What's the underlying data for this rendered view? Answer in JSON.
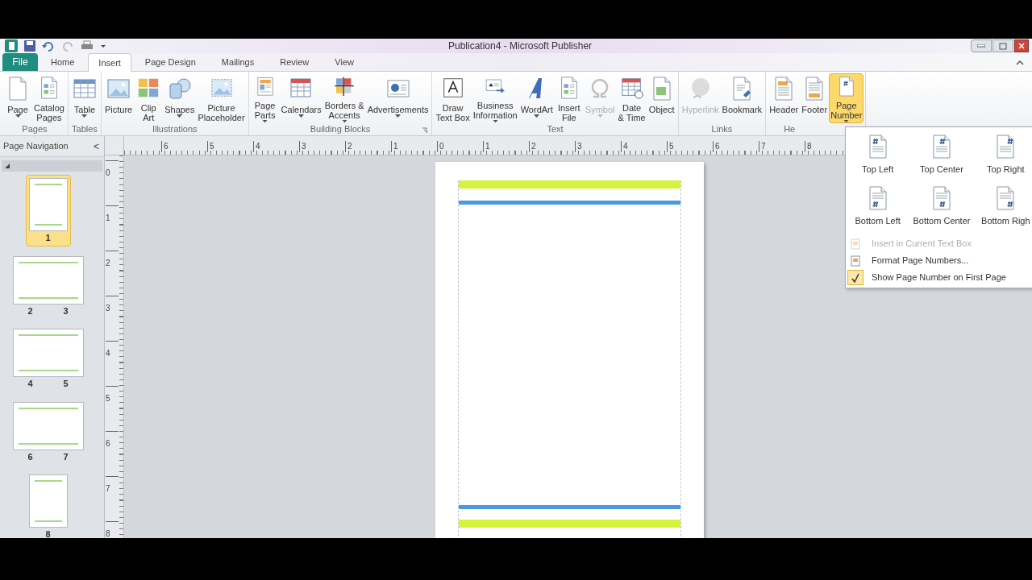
{
  "window": {
    "title": "Publication4  -  Microsoft Publisher"
  },
  "tabs": [
    {
      "label": "File",
      "kind": "file",
      "selected": false
    },
    {
      "label": "Home",
      "kind": "tab",
      "selected": false
    },
    {
      "label": "Insert",
      "kind": "tab",
      "selected": true
    },
    {
      "label": "Page Design",
      "kind": "tab",
      "selected": false
    },
    {
      "label": "Mailings",
      "kind": "tab",
      "selected": false
    },
    {
      "label": "Review",
      "kind": "tab",
      "selected": false
    },
    {
      "label": "View",
      "kind": "tab",
      "selected": false
    }
  ],
  "ribbon": {
    "groups": [
      {
        "label": "Pages",
        "launcher": false,
        "buttons": [
          {
            "label": "Page",
            "dropdown": true,
            "disabled": false,
            "selected": false
          },
          {
            "label": "Catalog\nPages",
            "dropdown": false,
            "disabled": false,
            "selected": false
          }
        ]
      },
      {
        "label": "Tables",
        "launcher": false,
        "buttons": [
          {
            "label": "Table",
            "dropdown": true,
            "disabled": false,
            "selected": false
          }
        ]
      },
      {
        "label": "Illustrations",
        "launcher": false,
        "buttons": [
          {
            "label": "Picture",
            "dropdown": false,
            "disabled": false,
            "selected": false
          },
          {
            "label": "Clip\nArt",
            "dropdown": false,
            "disabled": false,
            "selected": false
          },
          {
            "label": "Shapes",
            "dropdown": true,
            "disabled": false,
            "selected": false
          },
          {
            "label": "Picture\nPlaceholder",
            "dropdown": false,
            "disabled": false,
            "selected": false
          }
        ]
      },
      {
        "label": "Building Blocks",
        "launcher": true,
        "buttons": [
          {
            "label": "Page\nParts",
            "dropdown": true,
            "disabled": false,
            "selected": false
          },
          {
            "label": "Calendars",
            "dropdown": true,
            "disabled": false,
            "selected": false
          },
          {
            "label": "Borders &\nAccents",
            "dropdown": true,
            "disabled": false,
            "selected": false
          },
          {
            "label": "Advertisements",
            "dropdown": true,
            "disabled": false,
            "selected": false
          }
        ]
      },
      {
        "label": "Text",
        "launcher": false,
        "buttons": [
          {
            "label": "Draw\nText Box",
            "dropdown": false,
            "disabled": false,
            "selected": false
          },
          {
            "label": "Business\nInformation",
            "dropdown": true,
            "disabled": false,
            "selected": false
          },
          {
            "label": "WordArt",
            "dropdown": true,
            "disabled": false,
            "selected": false
          },
          {
            "label": "Insert\nFile",
            "dropdown": false,
            "disabled": false,
            "selected": false
          },
          {
            "label": "Symbol",
            "dropdown": true,
            "disabled": true,
            "selected": false
          },
          {
            "label": "Date\n& Time",
            "dropdown": false,
            "disabled": false,
            "selected": false
          },
          {
            "label": "Object",
            "dropdown": false,
            "disabled": false,
            "selected": false
          }
        ]
      },
      {
        "label": "Links",
        "launcher": false,
        "buttons": [
          {
            "label": "Hyperlink",
            "dropdown": false,
            "disabled": true,
            "selected": false
          },
          {
            "label": "Bookmark",
            "dropdown": false,
            "disabled": false,
            "selected": false
          }
        ]
      },
      {
        "label": "He",
        "launcher": false,
        "buttons": [
          {
            "label": "Header",
            "dropdown": false,
            "disabled": false,
            "selected": false
          },
          {
            "label": "Footer",
            "dropdown": false,
            "disabled": false,
            "selected": false
          },
          {
            "label": "Page\nNumber",
            "dropdown": true,
            "disabled": false,
            "selected": true
          }
        ]
      }
    ]
  },
  "nav_pane": {
    "title": "Page Navigation",
    "collapse": "<",
    "pages": [
      {
        "numbers": [
          "1"
        ],
        "kind": "single",
        "selected": true
      },
      {
        "numbers": [
          "2",
          "3"
        ],
        "kind": "spread",
        "selected": false
      },
      {
        "numbers": [
          "4",
          "5"
        ],
        "kind": "spread",
        "selected": false
      },
      {
        "numbers": [
          "6",
          "7"
        ],
        "kind": "spread",
        "selected": false
      },
      {
        "numbers": [
          "8"
        ],
        "kind": "single",
        "selected": false
      }
    ]
  },
  "rulers": {
    "horizontal": [
      "6",
      "5",
      "4",
      "3",
      "2",
      "1",
      "0",
      "1",
      "2",
      "3",
      "4",
      "5",
      "6",
      "7",
      "8"
    ],
    "vertical": [
      "0",
      "1",
      "2",
      "3",
      "4",
      "5",
      "6",
      "7",
      "8"
    ]
  },
  "page_number_menu": {
    "positions": [
      {
        "label": "Top Left",
        "kind": "top-left"
      },
      {
        "label": "Top Center",
        "kind": "top-center"
      },
      {
        "label": "Top Right",
        "kind": "top-right"
      },
      {
        "label": "Bottom Left",
        "kind": "bottom-left"
      },
      {
        "label": "Bottom Center",
        "kind": "bottom-center"
      },
      {
        "label": "Bottom Righ",
        "kind": "bottom-right"
      }
    ],
    "items": [
      {
        "label": "Insert in Current Text Box",
        "disabled": true,
        "checked": false
      },
      {
        "label": "Format Page Numbers...",
        "disabled": false,
        "checked": false
      },
      {
        "label": "Show Page Number on First Page",
        "disabled": false,
        "checked": true
      }
    ]
  }
}
